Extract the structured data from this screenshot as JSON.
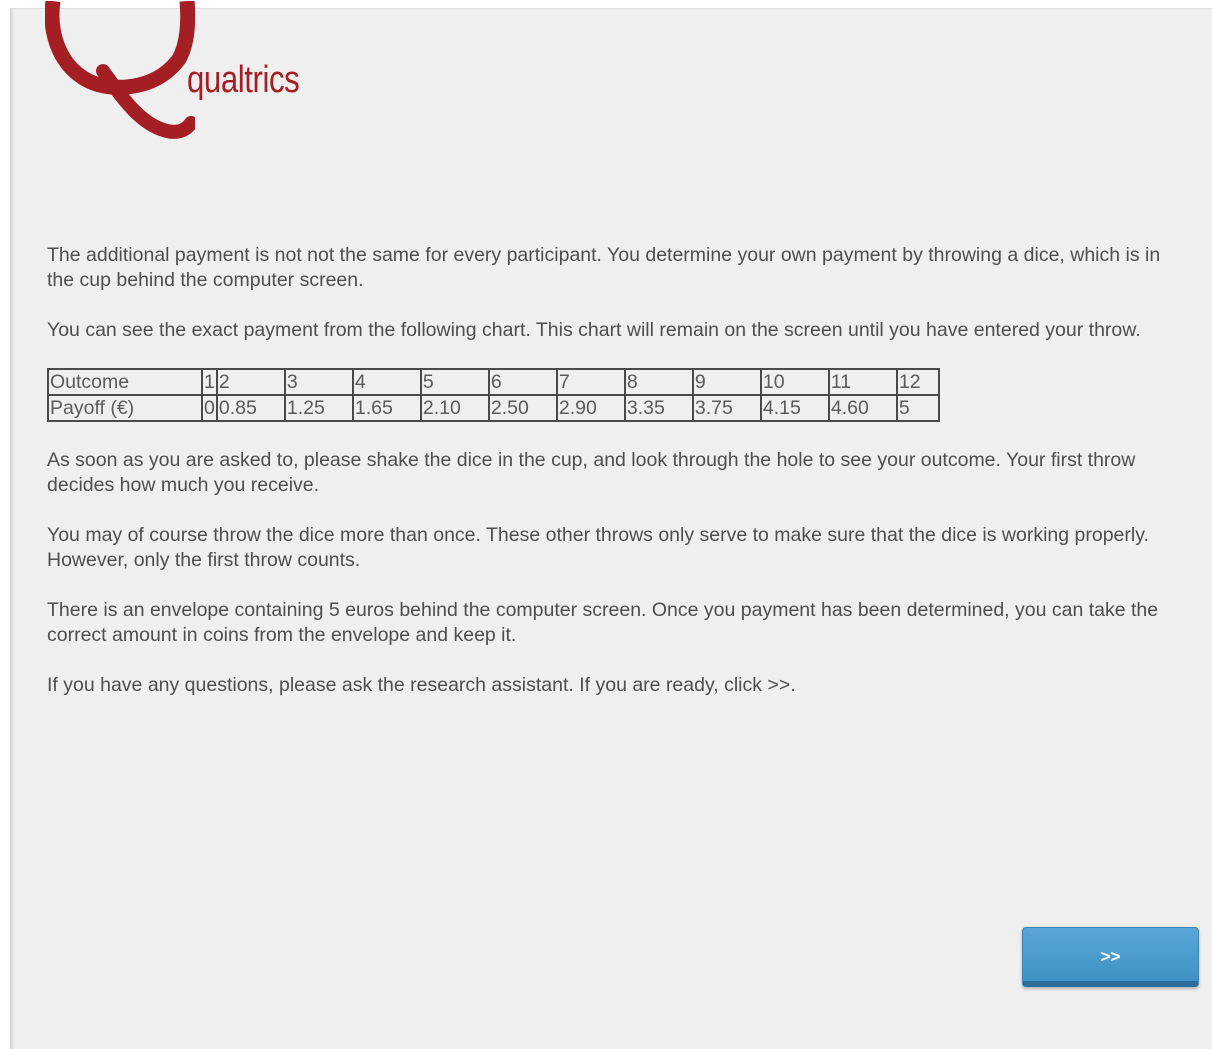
{
  "logo": {
    "text": "qualtrics",
    "color": "#a31f24"
  },
  "intro": {
    "paragraph1": "The additional payment is not not the same for every participant. You determine your own payment by throwing a dice, which is in the cup behind the computer screen.",
    "paragraph2": "You can see the exact payment from the following chart. This chart will remain on the screen until you have entered your throw."
  },
  "table": {
    "row_labels": [
      "Outcome",
      "Payoff  (€)"
    ],
    "outcomes": [
      "1",
      "2",
      "3",
      "4",
      "5",
      "6",
      "7",
      "8",
      "9",
      "10",
      "11",
      "12"
    ],
    "payoffs": [
      "0",
      "0.85",
      "1.25",
      "1.65",
      "2.10",
      "2.50",
      "2.90",
      "3.35",
      "3.75",
      "4.15",
      "4.60",
      "5"
    ]
  },
  "instructions": {
    "paragraph3": "As soon as you are asked to, please shake the dice in the cup, and look through the hole to see your outcome. Your first throw decides how much you receive.",
    "paragraph4": "You may of course throw the dice more than once. These other throws only serve to make sure that the dice is working properly. However, only the first throw counts.",
    "paragraph5": "There is an envelope containing 5 euros behind the computer screen. Once you payment has been determined, you can take the correct amount in coins from the envelope and keep it.",
    "paragraph6": "If you have any questions, please ask the research assistant. If you are ready, click >>."
  },
  "navigation": {
    "next_label": ">>",
    "button_color": "#4b9dcf"
  }
}
